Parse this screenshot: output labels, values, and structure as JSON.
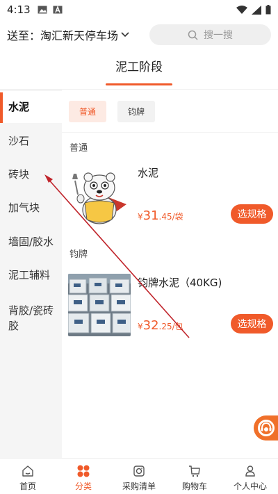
{
  "status_bar": {
    "time": "4:13"
  },
  "top_bar": {
    "deliver_to": "送至：淘汇新天停车场",
    "search_placeholder": "搜一搜"
  },
  "header": {
    "title": "泥工阶段"
  },
  "sidebar": {
    "items": [
      {
        "label": "水泥",
        "active": true
      },
      {
        "label": "沙石",
        "active": false
      },
      {
        "label": "砖块",
        "active": false
      },
      {
        "label": "加气块",
        "active": false
      },
      {
        "label": "墙固/胶水",
        "active": false
      },
      {
        "label": "泥工辅料",
        "active": false
      },
      {
        "label": "背胶/瓷砖胶",
        "active": false
      }
    ]
  },
  "chips": [
    {
      "label": "普通",
      "active": true
    },
    {
      "label": "钧牌",
      "active": false
    }
  ],
  "sections": [
    {
      "label": "普通",
      "product": {
        "name": "水泥",
        "price_symbol": "¥",
        "price_int": "31",
        "price_rest": ".45/袋",
        "button": "选规格"
      }
    },
    {
      "label": "钧牌",
      "product": {
        "name": "钧牌水泥（40KG)",
        "price_symbol": "¥",
        "price_int": "32",
        "price_rest": ".25/包",
        "button": "选规格"
      }
    }
  ],
  "tabbar": {
    "items": [
      {
        "label": "首页",
        "icon": "home-icon",
        "active": false
      },
      {
        "label": "分类",
        "icon": "category-icon",
        "active": true
      },
      {
        "label": "采购清单",
        "icon": "purchase-list-icon",
        "active": false
      },
      {
        "label": "购物车",
        "icon": "cart-icon",
        "active": false
      },
      {
        "label": "个人中心",
        "icon": "profile-icon",
        "active": false
      }
    ]
  },
  "colors": {
    "accent": "#f05a2a",
    "sidebar_bg": "#f5f5f5",
    "chip_active_bg": "#fdeae3",
    "arrow": "#c0242b"
  }
}
